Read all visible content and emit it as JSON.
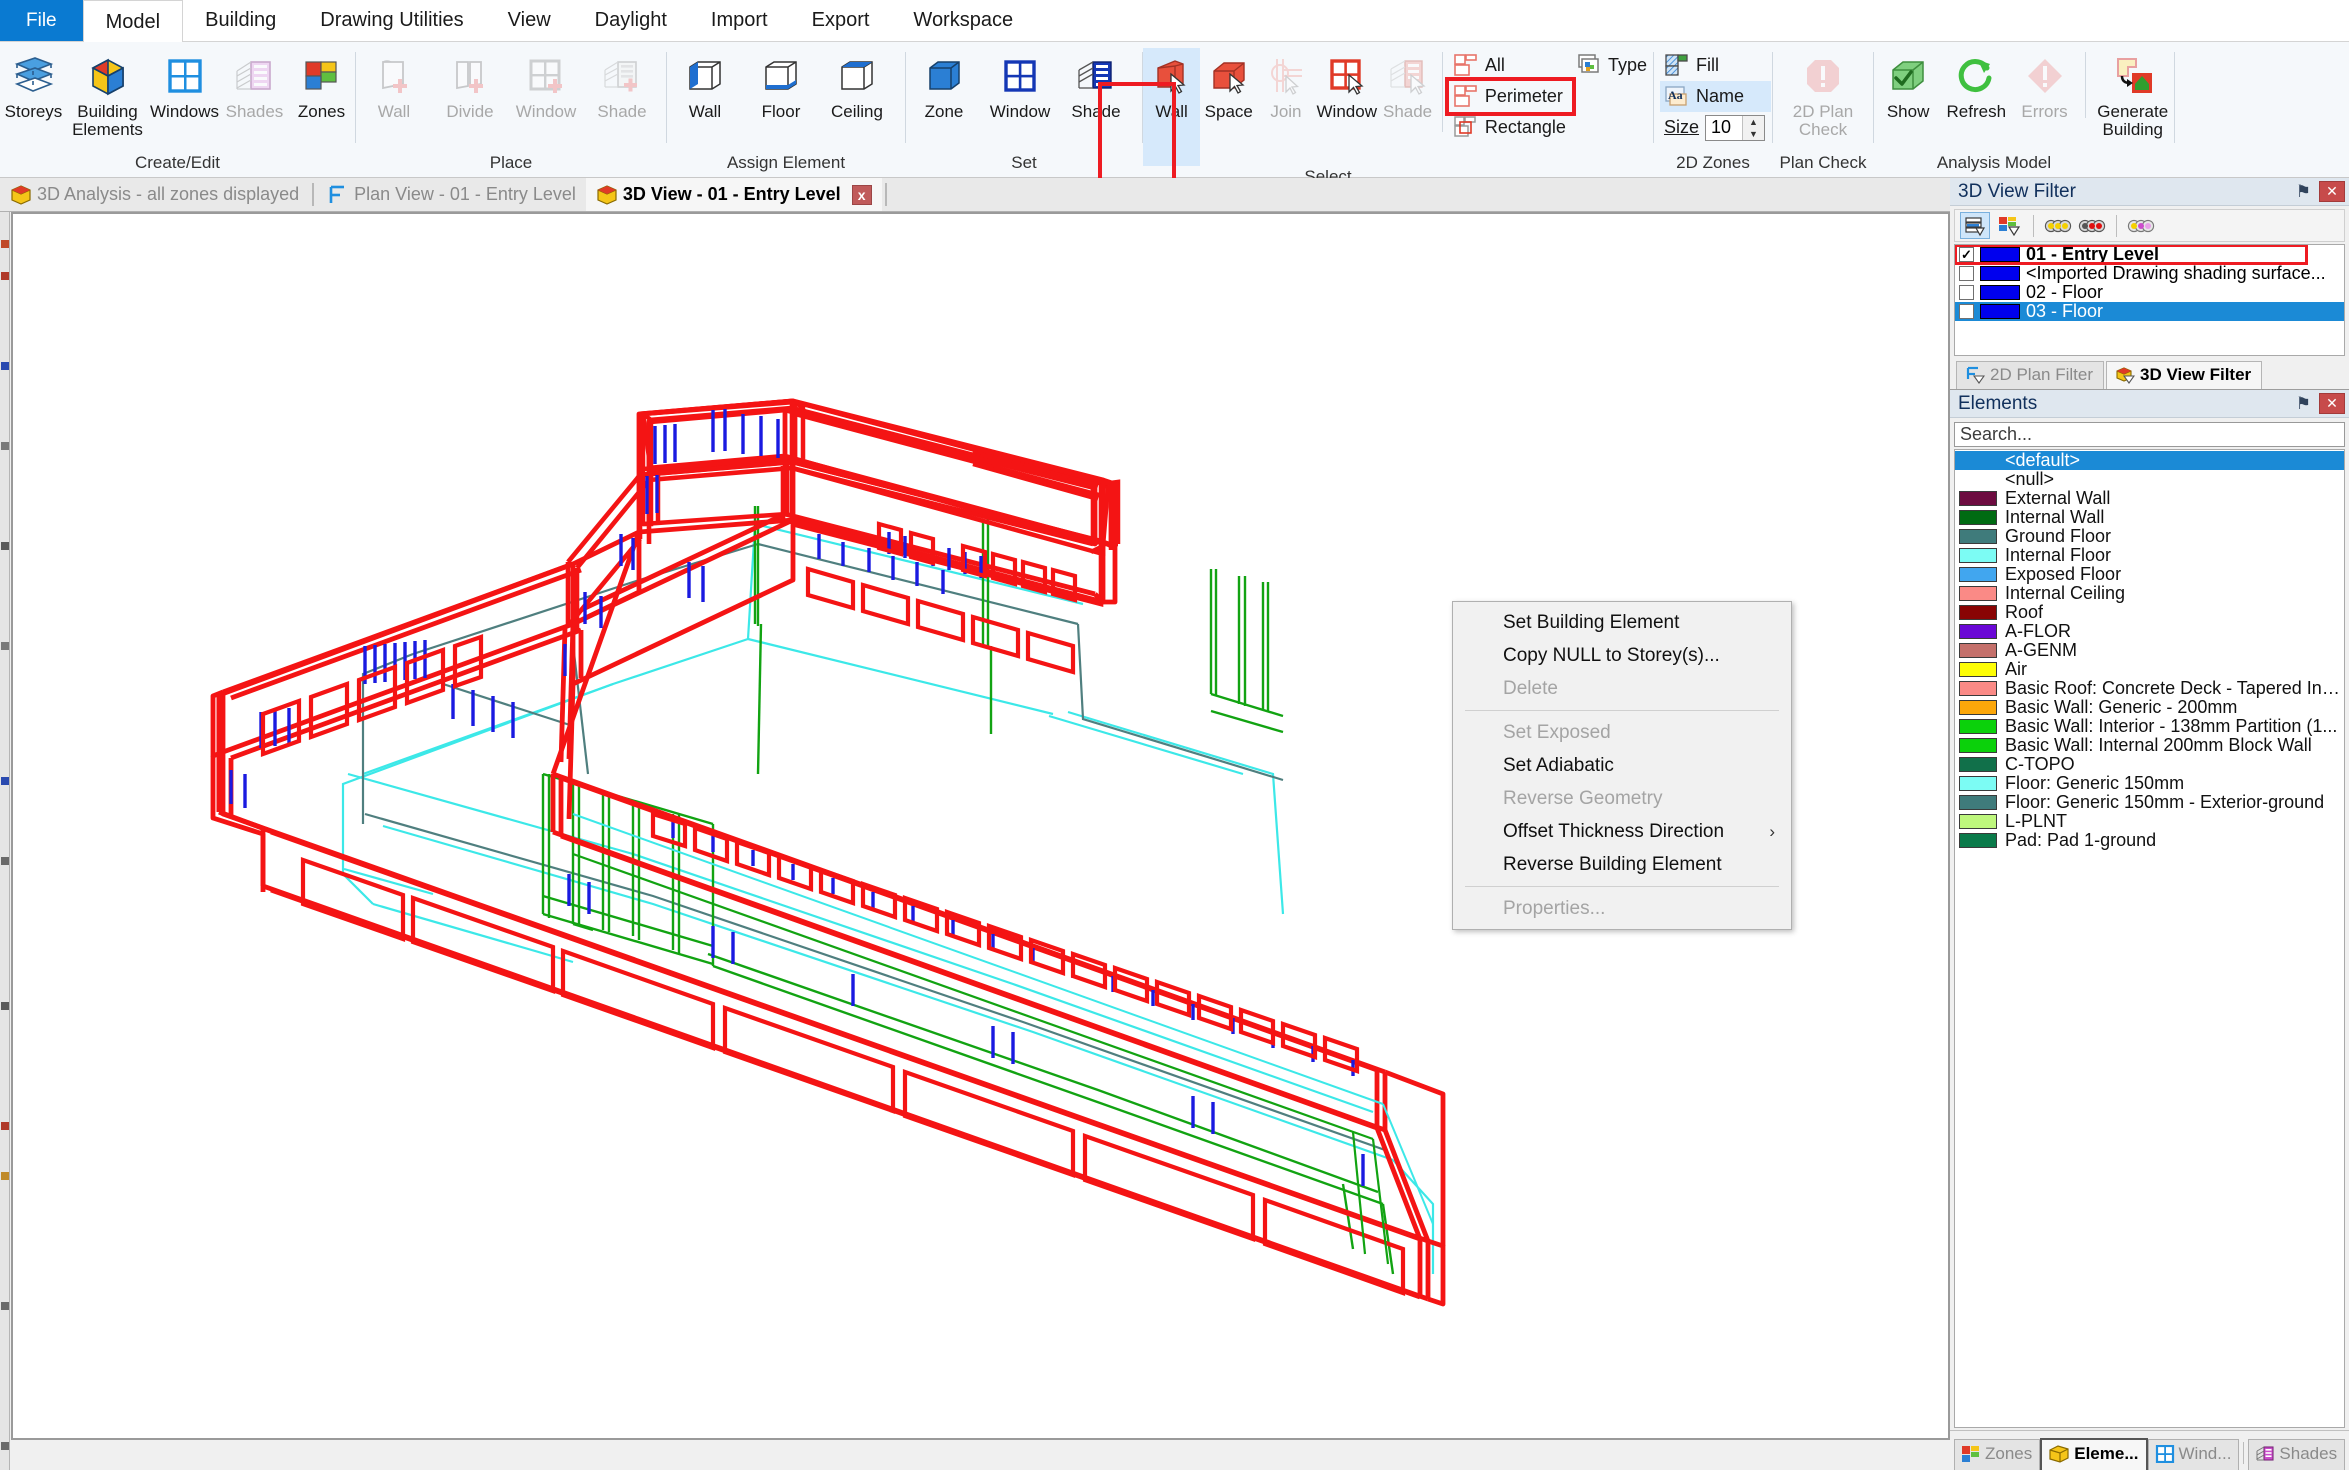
{
  "ribbon": {
    "tabs": [
      {
        "label": "File",
        "kind": "file"
      },
      {
        "label": "Model",
        "kind": "active"
      },
      {
        "label": "Building",
        "kind": "normal"
      },
      {
        "label": "Drawing Utilities",
        "kind": "normal"
      },
      {
        "label": "View",
        "kind": "normal"
      },
      {
        "label": "Daylight",
        "kind": "normal"
      },
      {
        "label": "Import",
        "kind": "normal"
      },
      {
        "label": "Export",
        "kind": "normal"
      },
      {
        "label": "Workspace",
        "kind": "normal"
      }
    ],
    "groups": [
      {
        "label": "Create/Edit",
        "buttons": [
          {
            "label": "Storeys",
            "icon": "storeys-icon",
            "disabled": false
          },
          {
            "label": "Building Elements",
            "icon": "building-elements-icon",
            "disabled": false
          },
          {
            "label": "Windows",
            "icon": "windows-icon",
            "disabled": false
          },
          {
            "label": "Shades",
            "icon": "shades-icon",
            "disabled": true
          },
          {
            "label": "Zones",
            "icon": "zones-icon",
            "disabled": false
          }
        ]
      },
      {
        "label": "Place",
        "buttons": [
          {
            "label": "Wall",
            "icon": "place-wall-icon",
            "disabled": true
          },
          {
            "label": "Divide",
            "icon": "place-divide-icon",
            "disabled": true
          },
          {
            "label": "Window",
            "icon": "place-window-icon",
            "disabled": true
          },
          {
            "label": "Shade",
            "icon": "place-shade-icon",
            "disabled": true
          }
        ]
      },
      {
        "label": "Assign Element",
        "buttons": [
          {
            "label": "Wall",
            "icon": "assign-wall-icon",
            "disabled": false
          },
          {
            "label": "Floor",
            "icon": "assign-floor-icon",
            "disabled": false
          },
          {
            "label": "Ceiling",
            "icon": "assign-ceiling-icon",
            "disabled": false
          }
        ]
      },
      {
        "label": "Set",
        "buttons": [
          {
            "label": "Zone",
            "icon": "set-zone-icon",
            "disabled": false
          },
          {
            "label": "Window",
            "icon": "set-window-icon",
            "disabled": false
          },
          {
            "label": "Shade",
            "icon": "set-shade-icon",
            "disabled": false
          }
        ]
      },
      {
        "label": "Select",
        "buttons": [
          {
            "label": "Wall",
            "icon": "select-wall-icon",
            "disabled": false,
            "selected": true,
            "highlighted": true
          },
          {
            "label": "Space",
            "icon": "select-space-icon",
            "disabled": false
          },
          {
            "label": "Join",
            "icon": "select-join-icon",
            "disabled": true
          },
          {
            "label": "Window",
            "icon": "select-window-icon",
            "disabled": false
          },
          {
            "label": "Shade",
            "icon": "select-shade-icon",
            "disabled": true
          }
        ],
        "small": [
          {
            "label": "All",
            "icon": "select-all-icon",
            "disabled": false
          },
          {
            "label": "Perimeter",
            "icon": "select-perimeter-icon",
            "disabled": false,
            "highlighted": true
          },
          {
            "label": "Rectangle",
            "icon": "select-rectangle-icon",
            "disabled": false
          },
          {
            "label": "Type",
            "icon": "select-type-icon",
            "disabled": false
          }
        ]
      },
      {
        "label": "2D Zones",
        "small": [
          {
            "label": "Fill",
            "icon": "fill-icon",
            "disabled": false
          },
          {
            "label": "Name",
            "icon": "name-icon",
            "disabled": false,
            "highlighted": true
          }
        ],
        "size_label": "Size",
        "size_value": "10"
      },
      {
        "label": "Plan Check",
        "buttons": [
          {
            "label": "2D Plan Check",
            "icon": "plan-check-icon",
            "disabled": true
          }
        ]
      },
      {
        "label": "Analysis Model",
        "buttons": [
          {
            "label": "Show",
            "icon": "show-icon",
            "disabled": false
          },
          {
            "label": "Refresh",
            "icon": "refresh-icon",
            "disabled": false
          },
          {
            "label": "Errors",
            "icon": "errors-icon",
            "disabled": true
          },
          {
            "label": "Generate Building",
            "icon": "generate-building-icon",
            "disabled": false
          }
        ]
      }
    ]
  },
  "doc_tabs": [
    {
      "label": "3D Analysis - all zones displayed",
      "icon": "3d-analysis-icon",
      "active": false,
      "closeable": false
    },
    {
      "label": "Plan View - 01 - Entry Level",
      "icon": "plan-view-icon",
      "active": false,
      "closeable": false
    },
    {
      "label": "3D View - 01 - Entry Level",
      "icon": "3d-view-icon",
      "active": true,
      "closeable": true,
      "close_label": "x"
    }
  ],
  "filter_panel": {
    "title": "3D View Filter",
    "pin_label": "⚑",
    "close_label": "✕",
    "toolbar": [
      {
        "name": "storey-filter-icon",
        "active": true
      },
      {
        "name": "element-filter-icon",
        "active": false
      },
      {
        "name": "traffic-lights-all-icon",
        "active": false
      },
      {
        "name": "traffic-lights-red-icon",
        "active": false
      },
      {
        "name": "traffic-lights-magenta-icon",
        "active": false
      }
    ],
    "rows": [
      {
        "label": "01 - Entry Level",
        "checked": true,
        "color": "#0000ee",
        "selected": false,
        "bold": true,
        "outlined": true
      },
      {
        "label": "<Imported Drawing shading surface...",
        "checked": false,
        "color": "#0000ee",
        "selected": false,
        "bold": false,
        "outlined": false
      },
      {
        "label": "02 - Floor",
        "checked": false,
        "color": "#0000ee",
        "selected": false,
        "bold": false,
        "outlined": false
      },
      {
        "label": "03 - Floor",
        "checked": false,
        "color": "#0000ee",
        "selected": true,
        "bold": false,
        "outlined": false
      }
    ],
    "tabs": [
      {
        "label": "2D Plan Filter",
        "icon": "2d-plan-filter-icon",
        "active": false
      },
      {
        "label": "3D View Filter",
        "icon": "3d-view-filter-icon",
        "active": true
      }
    ]
  },
  "elements_panel": {
    "title": "Elements",
    "pin_label": "⚑",
    "close_label": "✕",
    "search_placeholder": "Search...",
    "items": [
      {
        "label": "<default>",
        "color": null,
        "selected": true
      },
      {
        "label": "<null>",
        "color": null,
        "selected": false
      },
      {
        "label": "External Wall",
        "color": "#6d0c40",
        "selected": false
      },
      {
        "label": "Internal Wall",
        "color": "#006b12",
        "selected": false
      },
      {
        "label": "Ground Floor",
        "color": "#3f7b7b",
        "selected": false
      },
      {
        "label": "Internal Floor",
        "color": "#7cfcf4",
        "selected": false
      },
      {
        "label": "Exposed Floor",
        "color": "#41a6ef",
        "selected": false
      },
      {
        "label": "Internal Ceiling",
        "color": "#fa8a86",
        "selected": false
      },
      {
        "label": "Roof",
        "color": "#890404",
        "selected": false
      },
      {
        "label": "A-FLOR",
        "color": "#6a08d6",
        "selected": false
      },
      {
        "label": "A-GENM",
        "color": "#c4706b",
        "selected": false
      },
      {
        "label": "Air",
        "color": "#fdfd05",
        "selected": false
      },
      {
        "label": "Basic Roof: Concrete Deck - Tapered Ins...",
        "color": "#fa8a86",
        "selected": false
      },
      {
        "label": "Basic Wall: Generic - 200mm",
        "color": "#fca70a",
        "selected": false
      },
      {
        "label": "Basic Wall: Interior - 138mm Partition (1...",
        "color": "#0bd10b",
        "selected": false
      },
      {
        "label": "Basic Wall: Internal 200mm Block Wall",
        "color": "#0bd10b",
        "selected": false
      },
      {
        "label": "C-TOPO",
        "color": "#11704a",
        "selected": false
      },
      {
        "label": "Floor: Generic 150mm",
        "color": "#7cfcf4",
        "selected": false
      },
      {
        "label": "Floor: Generic 150mm - Exterior-ground",
        "color": "#3f7b7b",
        "selected": false
      },
      {
        "label": "L-PLNT",
        "color": "#bef77d",
        "selected": false
      },
      {
        "label": "Pad: Pad 1-ground",
        "color": "#0a7a4a",
        "selected": false
      }
    ],
    "bottom_tabs": [
      {
        "label": "Zones",
        "icon": "zones-tab-icon",
        "active": false
      },
      {
        "label": "Eleme...",
        "icon": "elements-tab-icon",
        "active": true
      },
      {
        "label": "Wind...",
        "icon": "windows-tab-icon",
        "active": false
      },
      {
        "label": "Shades",
        "icon": "shades-tab-icon",
        "active": false
      }
    ]
  },
  "context_menu": {
    "items": [
      {
        "label": "Set Building Element",
        "disabled": false,
        "submenu": false
      },
      {
        "label": "Copy NULL to Storey(s)...",
        "disabled": false,
        "submenu": false
      },
      {
        "label": "Delete",
        "disabled": true,
        "submenu": false
      },
      {
        "separator": true
      },
      {
        "label": "Set Exposed",
        "disabled": true,
        "submenu": false
      },
      {
        "label": "Set Adiabatic",
        "disabled": false,
        "submenu": false
      },
      {
        "label": "Reverse Geometry",
        "disabled": true,
        "submenu": false
      },
      {
        "label": "Offset Thickness Direction",
        "disabled": false,
        "submenu": true,
        "arrow": "›"
      },
      {
        "label": "Reverse Building Element",
        "disabled": false,
        "submenu": false
      },
      {
        "separator": true
      },
      {
        "label": "Properties...",
        "disabled": true,
        "submenu": false
      }
    ]
  },
  "viewport": {
    "name": "3d-model-wireframe",
    "colors": {
      "wall": "#f41414",
      "window": "#1a1ae0",
      "internal_floor": "#3ce8e8",
      "ground_floor": "#4f7f7f",
      "internal_wall": "#12a312",
      "background": "#ffffff"
    }
  },
  "accent": {
    "highlight_red": "#ee1b22",
    "selection_blue": "#1b8ad6",
    "ribbon_file_blue": "#0a7ad1"
  }
}
